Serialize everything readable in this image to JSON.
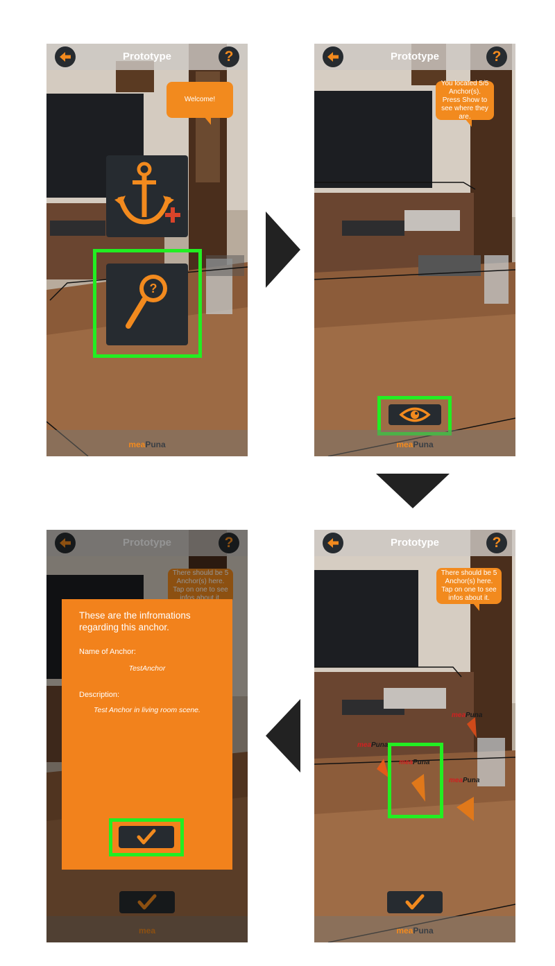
{
  "colors": {
    "accent": "#f28a1e",
    "dark": "#262b30",
    "highlight": "#22ee22"
  },
  "screens": [
    {
      "title": "Prototype",
      "help_symbol": "?",
      "bubble": "Welcome!",
      "logo_mark": "mea",
      "logo_text": "Puna",
      "buttons": [
        {
          "icon": "anchor-plus-icon"
        },
        {
          "icon": "magnifier-question-icon"
        }
      ]
    },
    {
      "title": "Prototype",
      "help_symbol": "?",
      "bubble": "You located 5/5 Anchor(s). Press Show to see where they are.",
      "logo_mark": "mea",
      "logo_text": "Puna",
      "buttons": [
        {
          "icon": "eye-icon"
        }
      ]
    },
    {
      "title": "Prototype",
      "help_symbol": "?",
      "bubble": "There should be 5 Anchor(s) here. Tap on one to see infos about it.",
      "logo_mark": "mea",
      "logo_text": "",
      "dialog": {
        "heading": "These are the infromations regarding this anchor.",
        "name_label": "Name of Anchor:",
        "name_value": "TestAnchor",
        "desc_label": "Description:",
        "desc_value": "Test Anchor in living room scene."
      },
      "buttons": [
        {
          "icon": "check-icon"
        }
      ]
    },
    {
      "title": "Prototype",
      "help_symbol": "?",
      "bubble": "There should be 5 Anchor(s) here. Tap on one to see infos about it.",
      "logo_mark": "mea",
      "logo_text": "Puna",
      "markers": [
        {
          "mark": "mea",
          "text": "Puna"
        },
        {
          "mark": "mea",
          "text": "Puna"
        },
        {
          "mark": "mea",
          "text": "Puna"
        },
        {
          "mark": "mea",
          "text": "Puna"
        }
      ],
      "buttons": [
        {
          "icon": "check-icon"
        }
      ]
    }
  ]
}
